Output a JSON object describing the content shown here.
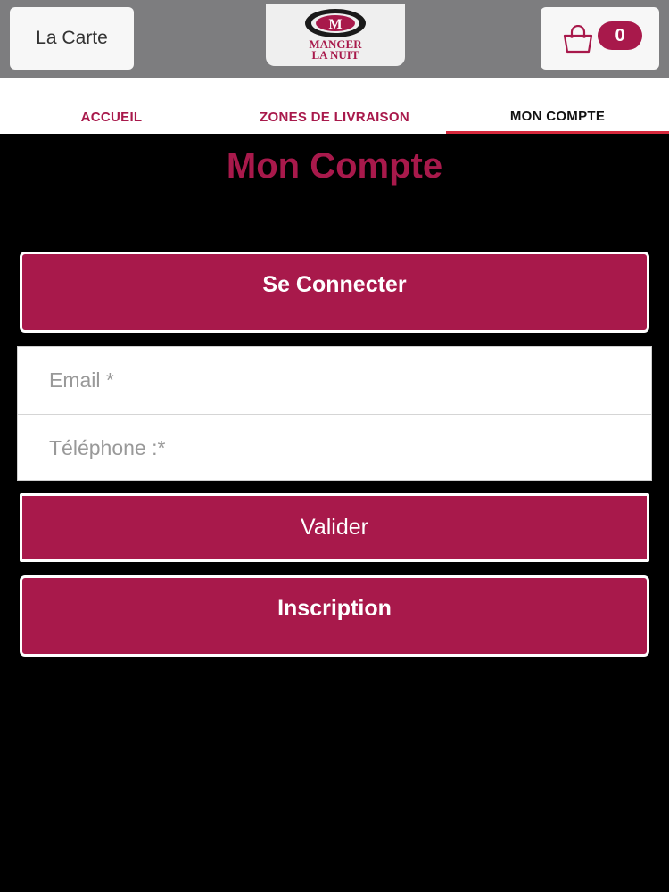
{
  "header": {
    "menu_label": "La Carte",
    "logo": {
      "line1": "MANGER",
      "line2": "LA NUIT",
      "emblem_letter": "M"
    },
    "cart": {
      "count": "0",
      "icon": "shopping-bag-icon"
    }
  },
  "tabs": [
    {
      "label": "ACCUEIL",
      "active": false
    },
    {
      "label": "ZONES DE LIVRAISON",
      "active": false
    },
    {
      "label": "MON COMPTE",
      "active": true
    }
  ],
  "page": {
    "title": "Mon Compte",
    "login_button": "Se Connecter",
    "form": {
      "email_placeholder": "Email *",
      "phone_placeholder": "Téléphone :*"
    },
    "submit_button": "Valider",
    "signup_button": "Inscription"
  },
  "colors": {
    "brand": "#a8194b",
    "header_bg": "#7d7d7f",
    "page_bg": "#000000",
    "active_tab_underline": "#d6283c"
  }
}
